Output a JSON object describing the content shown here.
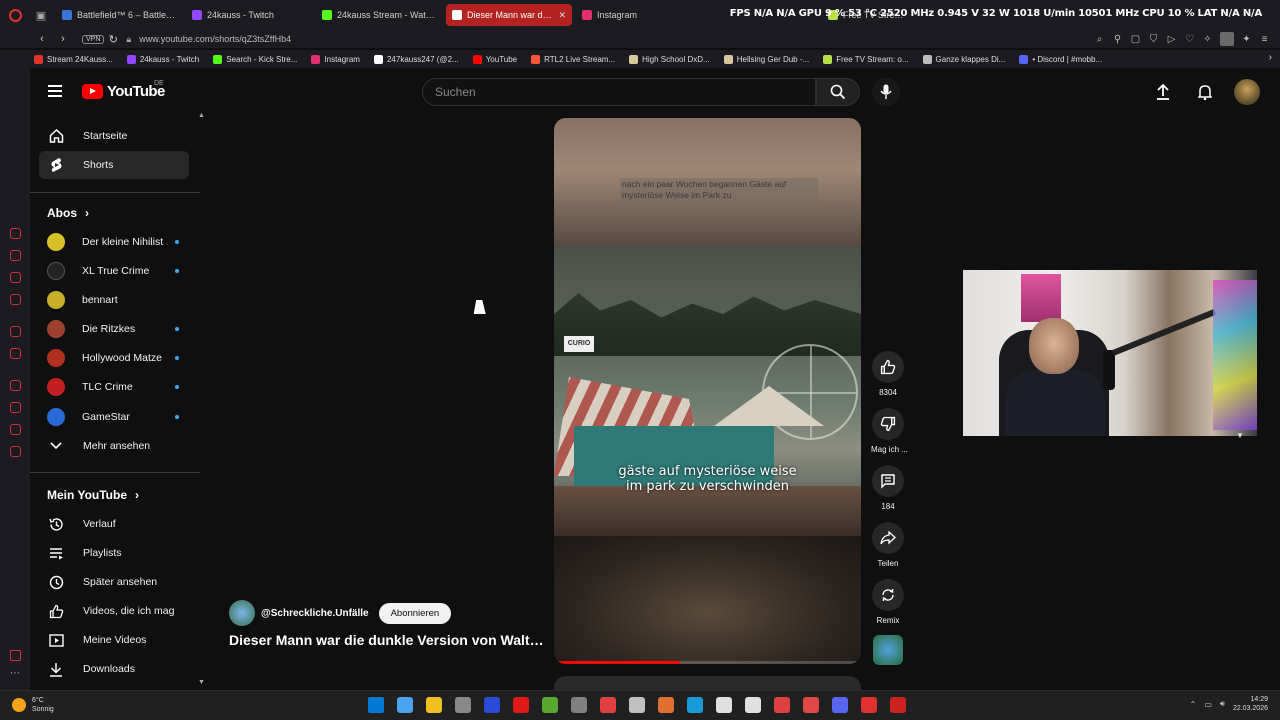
{
  "browser": {
    "tabs": [
      {
        "label": "Battlefield™ 6 – Battlefield",
        "color": "#3b74d9",
        "active": false
      },
      {
        "label": "24kauss - Twitch",
        "color": "#9146ff",
        "active": false
      },
      {
        "label": "24kauss Stream - Watch L",
        "color": "#53fc18",
        "active": false
      },
      {
        "label": "Dieser Mann war die d",
        "color": "#ffffff",
        "active": true
      },
      {
        "label": "Instagram",
        "color": "#e1306c",
        "active": false
      }
    ],
    "tab6": "Free TV Stream: online",
    "overlay_stats": "FPS N/A  N/A   GPU  9 %  53 °C  2520 MHz  0.945 V  32 W  1018 U/min  10501 MHz   CPU  10 %   LAT  N/A  N/A",
    "vpn_label": "VPN",
    "url": "www.youtube.com/shorts/qZ3tsZffHb4",
    "bookmarks": [
      {
        "label": "Stream 24Kauss...",
        "color": "#e1332b"
      },
      {
        "label": "24kauss - Twitch",
        "color": "#9146ff"
      },
      {
        "label": "Search - Kick Stre...",
        "color": "#53fc18"
      },
      {
        "label": "Instagram",
        "color": "#e1306c"
      },
      {
        "label": "247kauss247 (@2...",
        "color": "#ffffff"
      },
      {
        "label": "YouTube",
        "color": "#ff0000"
      },
      {
        "label": "RTL2 Live Stream...",
        "color": "#ff5533"
      },
      {
        "label": "High School DxD...",
        "color": "#d8c79a"
      },
      {
        "label": "Hellsing Ger Dub -...",
        "color": "#d8c79a"
      },
      {
        "label": "Free TV Stream: o...",
        "color": "#b8e04a"
      },
      {
        "label": "Ganze klappes Di...",
        "color": "#bbbbbb"
      },
      {
        "label": "• Discord | #mobb...",
        "color": "#5865f2"
      }
    ]
  },
  "youtube": {
    "logo_text": "YouTube",
    "country": "DE",
    "search_placeholder": "Suchen",
    "guide": {
      "main": [
        {
          "label": "Startseite",
          "icon": "home-icon",
          "selected": false
        },
        {
          "label": "Shorts",
          "icon": "shorts-icon",
          "selected": true
        }
      ],
      "subscriptions_title": "Abos",
      "subscriptions": [
        {
          "label": "Der kleine Nihilist",
          "color": "#d8c02a",
          "dot": true
        },
        {
          "label": "XL True Crime",
          "color": "#222222",
          "dot": true
        },
        {
          "label": "bennart",
          "color": "#c8b02a",
          "dot": false
        },
        {
          "label": "Die Ritzkes",
          "color": "#a04030",
          "dot": true
        },
        {
          "label": "Hollywood Matze",
          "color": "#b03020",
          "dot": true
        },
        {
          "label": "TLC Crime",
          "color": "#c02020",
          "dot": true
        },
        {
          "label": "GameStar",
          "color": "#2a6ad8",
          "dot": true
        }
      ],
      "more_label": "Mehr ansehen",
      "you_title": "Mein YouTube",
      "you_items": [
        {
          "label": "Verlauf",
          "icon": "history-icon"
        },
        {
          "label": "Playlists",
          "icon": "playlists-icon"
        },
        {
          "label": "Später ansehen",
          "icon": "watch-later-icon"
        },
        {
          "label": "Videos, die ich mag",
          "icon": "liked-videos-icon"
        },
        {
          "label": "Meine Videos",
          "icon": "your-videos-icon"
        },
        {
          "label": "Downloads",
          "icon": "downloads-icon"
        }
      ]
    },
    "short": {
      "top_caption": "nach ein paar Wochen begannen Gäste auf mysteriöse Weise im Park zu",
      "caption_line1": "gäste auf mysteriöse weise",
      "caption_line2": "im park zu verschwinden",
      "fair_sign": "CURIO",
      "progress": 0.41,
      "channel": "@Schreckliche.Unfälle",
      "subscribe_label": "Abonnieren",
      "title": "Dieser Mann war die dunkle Version von Walt ..."
    },
    "actions": {
      "likes": "8304",
      "dislike_label": "Mag ich ...",
      "comments": "184",
      "share_label": "Teilen",
      "remix_label": "Remix"
    }
  },
  "taskbar": {
    "temp": "6°C",
    "weather": "Sonnig",
    "time": "14:29",
    "date": "22.03.2026",
    "apps": [
      "#0078d4",
      "#4aa3f0",
      "#f0c020",
      "#888888",
      "#2a4ad8",
      "#e01818",
      "#58a830",
      "#808080",
      "#e04040",
      "#c0c0c0",
      "#e07030",
      "#1b9ad8",
      "#e0e0e0",
      "#e0e0e0",
      "#dd4040",
      "#e04848",
      "#5865f2",
      "#e03030",
      "#cc2222"
    ]
  }
}
